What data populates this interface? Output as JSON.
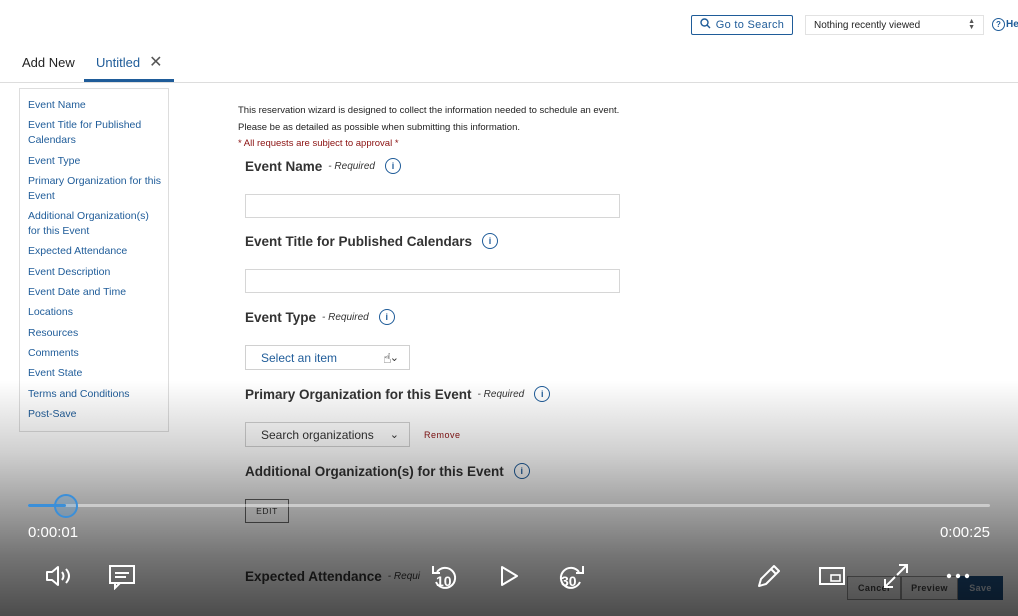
{
  "topbar": {
    "search_label": "Go to Search",
    "recent_label": "Nothing recently viewed",
    "help_label": "He"
  },
  "tabs": [
    {
      "label": "Add New"
    },
    {
      "label": "Untitled"
    }
  ],
  "sidebar": {
    "items": [
      {
        "label": "Event Name"
      },
      {
        "label": "Event Title for Published Calendars"
      },
      {
        "label": "Event Type"
      },
      {
        "label": "Primary Organization for this Event"
      },
      {
        "label": "Additional Organization(s) for this Event"
      },
      {
        "label": "Expected Attendance"
      },
      {
        "label": "Event Description"
      },
      {
        "label": "Event Date and Time"
      },
      {
        "label": "Locations"
      },
      {
        "label": "Resources"
      },
      {
        "label": "Comments"
      },
      {
        "label": "Event State"
      },
      {
        "label": "Terms and Conditions"
      },
      {
        "label": "Post-Save"
      }
    ]
  },
  "intro": {
    "line1": "This reservation wizard is designed to collect the information needed to schedule an event.",
    "line2": "Please be as detailed as possible when submitting this information.",
    "line3": "* All requests are subject to approval *"
  },
  "form": {
    "event_name": {
      "label": "Event Name",
      "required": "- Required",
      "value": ""
    },
    "event_title": {
      "label": "Event Title for Published Calendars",
      "value": ""
    },
    "event_type": {
      "label": "Event Type",
      "required": "- Required",
      "placeholder": "Select an item"
    },
    "primary_org": {
      "label": "Primary Organization for this Event",
      "required": "- Required",
      "placeholder": "Search organizations",
      "remove_label": "Remove"
    },
    "additional_org": {
      "label": "Additional Organization(s) for this Event",
      "edit_label": "EDIT"
    },
    "expected_attendance": {
      "label": "Expected Attendance",
      "required": "- Requi"
    }
  },
  "actions": {
    "cancel_label": "Cancel",
    "preview_label": "Preview",
    "save_label": "Save"
  },
  "player": {
    "current_time": "0:00:01",
    "total_time": "0:00:25",
    "progress_fraction": 0.04,
    "skip_back_seconds": "10",
    "skip_forward_seconds": "30",
    "accent_color": "#3b8fd9"
  }
}
